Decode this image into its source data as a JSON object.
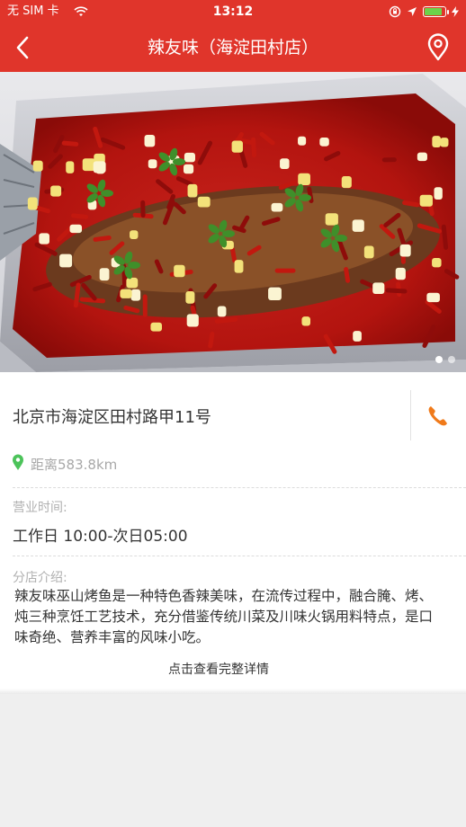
{
  "status_bar": {
    "carrier": "无 SIM 卡",
    "time": "13:12",
    "battery_level": 0.9,
    "battery_color": "#6cd34a"
  },
  "nav": {
    "title": "辣友味（海淀田村店）",
    "back_icon": "chevron-left-icon",
    "location_icon": "map-pin-icon",
    "color": "#e0352b"
  },
  "gallery": {
    "description_icon": "grilled-fish-photo",
    "page_count": 2,
    "active_index": 1
  },
  "store": {
    "address": "北京市海淀区田村路甲11号",
    "distance": "距离583.8km",
    "hours_label": "营业时间:",
    "hours": "工作日 10:00-次日05:00",
    "intro_label": "分店介绍:",
    "intro": "辣友味巫山烤鱼是一种特色香辣美味，在流传过程中，融合腌、烤、炖三种烹饪工艺技术，充分借鉴传统川菜及川味火锅用料特点，是口味奇绝、营养丰富的风味小吃。",
    "more_label": "点击查看完整详情",
    "phone_icon": "phone-icon",
    "phone_color": "#f07a1a",
    "pin_color": "#4cc35a"
  }
}
